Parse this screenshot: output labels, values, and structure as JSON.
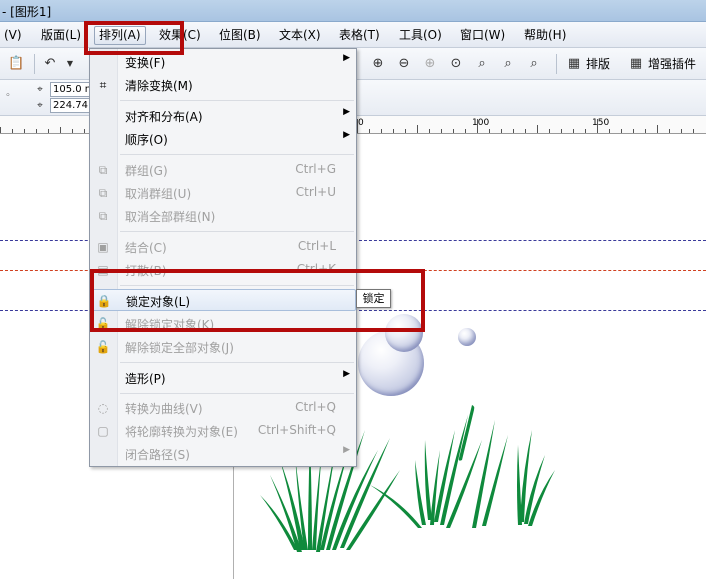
{
  "window": {
    "title": "- [图形1]"
  },
  "menubar": {
    "items": [
      {
        "label": "(V)"
      },
      {
        "label": "版面(L)"
      },
      {
        "label": "排列(A)"
      },
      {
        "label": "效果(C)"
      },
      {
        "label": "位图(B)"
      },
      {
        "label": "文本(X)"
      },
      {
        "label": "表格(T)"
      },
      {
        "label": "工具(O)"
      },
      {
        "label": "窗口(W)"
      },
      {
        "label": "帮助(H)"
      }
    ]
  },
  "toolbar": {
    "layout_label": "排版",
    "plugin_label": "增强插件"
  },
  "property_bar": {
    "x_value": "105.0 m",
    "y_value": "224.74"
  },
  "ruler": {
    "labels": [
      "0",
      "100",
      "150"
    ]
  },
  "arrange_menu": {
    "items": [
      {
        "label": "变换(F)",
        "shortcut": "",
        "submenu": true,
        "disabled": false
      },
      {
        "label": "清除变换(M)",
        "shortcut": "",
        "submenu": false,
        "disabled": false
      },
      {
        "label": "对齐和分布(A)",
        "shortcut": "",
        "submenu": true,
        "disabled": false
      },
      {
        "label": "顺序(O)",
        "shortcut": "",
        "submenu": true,
        "disabled": false
      },
      {
        "label": "群组(G)",
        "shortcut": "Ctrl+G",
        "submenu": false,
        "disabled": true
      },
      {
        "label": "取消群组(U)",
        "shortcut": "Ctrl+U",
        "submenu": false,
        "disabled": true
      },
      {
        "label": "取消全部群组(N)",
        "shortcut": "",
        "submenu": false,
        "disabled": true
      },
      {
        "label": "结合(C)",
        "shortcut": "Ctrl+L",
        "submenu": false,
        "disabled": true
      },
      {
        "label": "打散(B)",
        "shortcut": "Ctrl+K",
        "submenu": false,
        "disabled": true
      },
      {
        "label": "锁定对象(L)",
        "shortcut": "",
        "submenu": false,
        "disabled": false
      },
      {
        "label": "解除锁定对象(K)",
        "shortcut": "",
        "submenu": false,
        "disabled": true
      },
      {
        "label": "解除锁定全部对象(J)",
        "shortcut": "",
        "submenu": false,
        "disabled": true
      },
      {
        "label": "造形(P)",
        "shortcut": "",
        "submenu": true,
        "disabled": false
      },
      {
        "label": "转换为曲线(V)",
        "shortcut": "Ctrl+Q",
        "submenu": false,
        "disabled": true
      },
      {
        "label": "将轮廓转换为对象(E)",
        "shortcut": "Ctrl+Shift+Q",
        "submenu": false,
        "disabled": true
      },
      {
        "label": "闭合路径(S)",
        "shortcut": "",
        "submenu": true,
        "disabled": true
      }
    ]
  },
  "tooltip": {
    "text": "锁定"
  },
  "colors": {
    "highlight_box": "#b40a0a",
    "grass": "#0f8a3c"
  }
}
